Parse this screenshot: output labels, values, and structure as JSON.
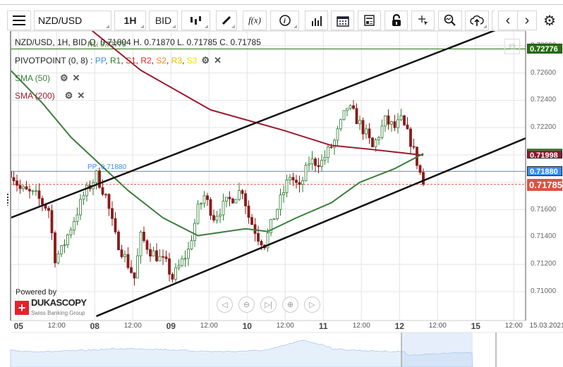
{
  "toolbar": {
    "menu_icon": "hamburger-icon",
    "symbol": "NZD/USD",
    "period": "1H",
    "side": "BID",
    "icons": [
      "candlestick-icon",
      "pencil-icon",
      "function-icon",
      "info-icon",
      "bar-chart-icon",
      "calendar-icon",
      "news-icon",
      "lock-icon",
      "crosshair-icon",
      "zoom-chart-icon",
      "cloud-upload-icon",
      "chevron-left-icon",
      "chevron-right-icon",
      "gear-icon"
    ],
    "fx": "f(x)"
  },
  "legend": {
    "ohlc": "NZD/USD, 1H, BID  O. 0.71804 H. 0.71870 L. 0.71785 C. 0.71785",
    "pivot_name": "PIVOTPOINT (0, 8)",
    "pivot_sep": " : ",
    "pivot_items": [
      {
        "t": "PP",
        "c": "#3b8ef0"
      },
      {
        "t": "R1",
        "c": "#2a7a1e"
      },
      {
        "t": "S1",
        "c": "#c0222b"
      },
      {
        "t": "R2",
        "c": "#ee2222"
      },
      {
        "t": "S2",
        "c": "#f08a1c"
      },
      {
        "t": "R3",
        "c": "#f0b800"
      },
      {
        "t": "S3",
        "c": "#f5e000"
      }
    ],
    "sma50": "SMA (50)",
    "sma200": "SMA (200)"
  },
  "chart_data": {
    "type": "candlestick",
    "ylim": [
      0.7082,
      0.7293
    ],
    "y_ticks": [
      "0.72800",
      "0.72600",
      "0.72400",
      "0.72200",
      "0.72000",
      "0.71800",
      "0.71600",
      "0.71400",
      "0.71200",
      "0.71000"
    ],
    "y_tick_values": [
      0.728,
      0.726,
      0.724,
      0.722,
      0.72,
      0.718,
      0.716,
      0.714,
      0.712,
      0.71
    ],
    "x_ticks": [
      {
        "h": 2.5,
        "t": "05",
        "day": true
      },
      {
        "h": 14.5,
        "t": "12:00"
      },
      {
        "h": 26.5,
        "t": "08",
        "day": true
      },
      {
        "h": 38.5,
        "t": "12:00"
      },
      {
        "h": 50.5,
        "t": "09",
        "day": true
      },
      {
        "h": 62.5,
        "t": "12:00"
      },
      {
        "h": 74.5,
        "t": "10",
        "day": true
      },
      {
        "h": 86.5,
        "t": "12:00"
      },
      {
        "h": 98.5,
        "t": "11",
        "day": true
      },
      {
        "h": 110.5,
        "t": "12:00"
      },
      {
        "h": 122.5,
        "t": "12",
        "day": true
      },
      {
        "h": 134.5,
        "t": "12:00"
      },
      {
        "h": 146.5,
        "t": "15",
        "day": true
      },
      {
        "h": 158.5,
        "t": "12:00"
      },
      {
        "h": 169,
        "t": "15.03.2021"
      }
    ],
    "price_path": [
      [
        0,
        0.7188
      ],
      [
        3,
        0.7175
      ],
      [
        8,
        0.717
      ],
      [
        12,
        0.716
      ],
      [
        14,
        0.7125
      ],
      [
        16,
        0.713
      ],
      [
        23,
        0.717
      ],
      [
        27,
        0.7185
      ],
      [
        30,
        0.717
      ],
      [
        33,
        0.714
      ],
      [
        37,
        0.712
      ],
      [
        39,
        0.711
      ],
      [
        41,
        0.714
      ],
      [
        44,
        0.713
      ],
      [
        49,
        0.712
      ],
      [
        51,
        0.711
      ],
      [
        56,
        0.713
      ],
      [
        59,
        0.716
      ],
      [
        61,
        0.717
      ],
      [
        64,
        0.7155
      ],
      [
        68,
        0.7165
      ],
      [
        73,
        0.7175
      ],
      [
        75,
        0.7155
      ],
      [
        78,
        0.714
      ],
      [
        80,
        0.7135
      ],
      [
        83,
        0.7155
      ],
      [
        88,
        0.7185
      ],
      [
        91,
        0.7175
      ],
      [
        94,
        0.7195
      ],
      [
        98,
        0.7195
      ],
      [
        102,
        0.721
      ],
      [
        106,
        0.7235
      ],
      [
        108,
        0.723
      ],
      [
        112,
        0.7215
      ],
      [
        114,
        0.7205
      ],
      [
        118,
        0.7225
      ],
      [
        121,
        0.722
      ],
      [
        123,
        0.7225
      ],
      [
        126,
        0.721
      ],
      [
        128,
        0.7195
      ],
      [
        130,
        0.71785
      ]
    ],
    "sma50": [
      [
        0,
        0.7262
      ],
      [
        10,
        0.7238
      ],
      [
        19,
        0.7213
      ],
      [
        37,
        0.7174
      ],
      [
        48,
        0.7154
      ],
      [
        59,
        0.7141
      ],
      [
        74,
        0.7146
      ],
      [
        81,
        0.7144
      ],
      [
        90,
        0.7154
      ],
      [
        101,
        0.7165
      ],
      [
        110,
        0.718
      ],
      [
        121,
        0.719
      ],
      [
        130,
        0.7201
      ]
    ],
    "sma200": [
      [
        23,
        0.7296
      ],
      [
        41,
        0.7262
      ],
      [
        63,
        0.7233
      ],
      [
        86,
        0.7218
      ],
      [
        101,
        0.7207
      ],
      [
        114,
        0.7204
      ],
      [
        130,
        0.71998
      ]
    ],
    "trendlines": [
      [
        [
          0,
          0.7154
        ],
        [
          159,
          0.7297
        ]
      ],
      [
        [
          27,
          0.7082
        ],
        [
          163,
          0.7213
        ]
      ]
    ],
    "levels": {
      "R1": 0.72776,
      "PP": 0.7188,
      "last": 0.71785,
      "sma200": 0.71998
    },
    "level_labels": {
      "R1": "0.72776",
      "PP": "0.71880",
      "last": "0.71785",
      "sma200": "0.71998",
      "R1_text": "R1: 0.72776",
      "PP_text": "PP: 0.71880"
    },
    "colors": {
      "up": "#2e7d32",
      "down": "#8b1a1a",
      "sma50": "#3a7d3a",
      "sma200": "#9b1b30",
      "R1": "#2a6e12",
      "PP": "#3b8ef0",
      "last": "#d9553f"
    }
  },
  "watermark": {
    "powered": "Powered by",
    "brand": "DUKASCOPY",
    "sub": "Swiss Banking Group"
  },
  "nav_buttons": [
    "scroll-left",
    "zoom-out",
    "scroll-to-end",
    "zoom-in",
    "scroll-right"
  ]
}
